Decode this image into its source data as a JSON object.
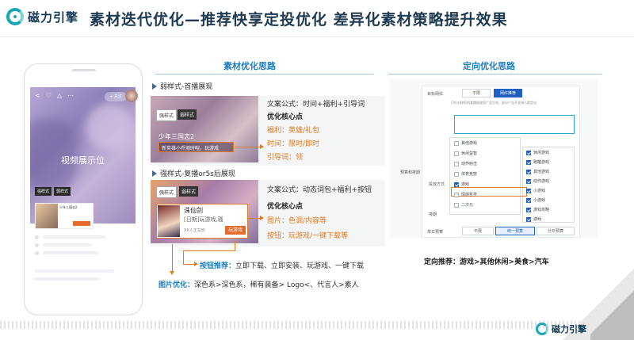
{
  "header": {
    "logo_text": "磁力引擎",
    "title": "素材迭代优化—推荐快享定投优化  差异化素材策略提升效果"
  },
  "phone": {
    "video_placeholder": "视频展示位",
    "follow_label": "+ 关注",
    "tags": [
      "强样式",
      "弱样式"
    ],
    "ad_title": "少年三国志2"
  },
  "material": {
    "section_title": "素材优化思路",
    "weak": {
      "heading": "弱样式-首播展现",
      "chip_strong": "强样式",
      "chip_weak": "弱样式",
      "game_title": "少年三国志2",
      "game_line": "新英雄小乔测时暄，玩游戏",
      "formula": "文案公式：时间+福利+引导词",
      "core_title": "优化核心点",
      "points": [
        {
          "label": "福利：",
          "value": "英雄/礼包"
        },
        {
          "label": "时间：",
          "value": "限时/即时"
        },
        {
          "label": "引导词：",
          "value": "领"
        }
      ]
    },
    "strong": {
      "heading": "强样式-复播or5s后展现",
      "chip_strong": "强样式",
      "chip_weak": "弱样式",
      "game_name": "诛仙剑",
      "game_desc": "[日期]玩游戏,骚",
      "game_by": "XX人正在玩",
      "play_button": "玩游戏",
      "formula": "文案公式：动态词包+福利+按钮",
      "core_title": "优化核心点",
      "points": [
        {
          "label": "图片：",
          "value": "色调/内容等"
        },
        {
          "label": "按钮：",
          "value": "玩游戏/一键下载等"
        }
      ]
    },
    "button_rec_label": "按钮推荐：",
    "button_rec_value": "立即下载、立即安装、玩游戏、一键下载",
    "image_opt_label": "图片优化：",
    "image_opt_value": "深色系>深色系，稀有装备> Logo<、代言人>素人"
  },
  "targeting": {
    "section_title": "定向优化思路",
    "row1_label": "目标网红",
    "row1_opts": [
      "不限",
      "网红推荐"
    ],
    "hint": "只针对按您的喜播放放您广告生效，部分广告不支持人群定向",
    "side_labels": [
      "预算和排期",
      "投放方式",
      "排期",
      "单日预算"
    ],
    "left_list": [
      "其他游戏",
      "休闲益智",
      "动作射击",
      "体育竞技",
      "游戏",
      "情感哲学",
      "二次元"
    ],
    "left_checked": [
      false,
      false,
      false,
      false,
      true,
      false,
      false
    ],
    "right_list": [
      "休闲游戏",
      "跑酷游戏",
      "其他游戏",
      "动作游戏",
      "小游戏",
      "小游戏",
      "游戏攻略",
      "游戏"
    ],
    "right_checked": [
      true,
      true,
      true,
      true,
      true,
      true,
      true,
      true
    ],
    "budget_opts": [
      "不限",
      "统一预算",
      "分日预算"
    ],
    "recommendation": "定向推荐：游戏>其他休闲>美食>汽车"
  },
  "footer": {
    "logo_text": "磁力引擎"
  }
}
